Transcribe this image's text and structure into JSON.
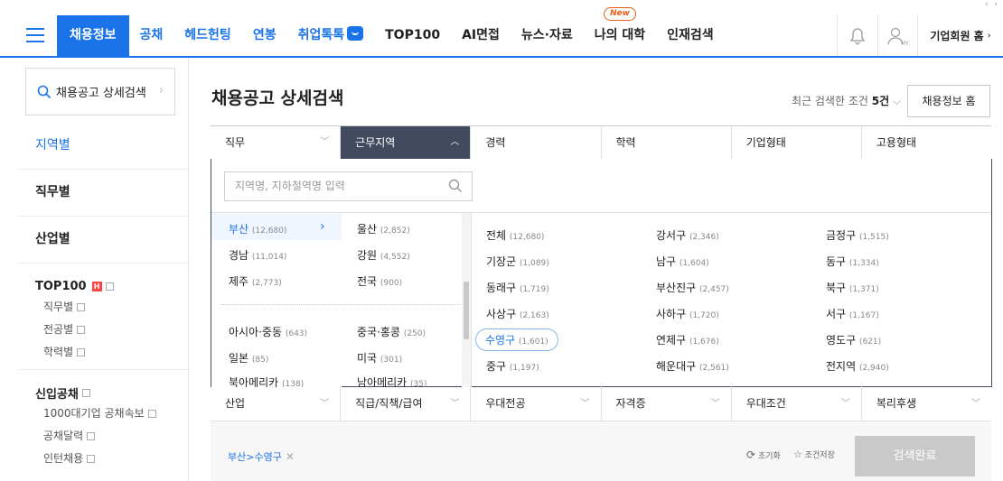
{
  "header": {
    "menu": [
      {
        "label": "채용정보",
        "active": true
      },
      {
        "label": "공채"
      },
      {
        "label": "헤드헌팅"
      },
      {
        "label": "연봉"
      },
      {
        "label": "취업톡톡"
      },
      {
        "label": "TOP100"
      },
      {
        "label": "AI면접"
      },
      {
        "label": "뉴스·자료"
      },
      {
        "label": "나의 대학",
        "badge": "New"
      },
      {
        "label": "인재검색"
      }
    ],
    "my_label": "MY",
    "corp_label": "기업회원 홈"
  },
  "sidebar": {
    "search_label": "채용공고 상세검색",
    "big_items": [
      "지역별",
      "직무별",
      "산업별"
    ],
    "top100": {
      "title": "TOP100",
      "hot_badge": "H",
      "subs": [
        "직무별",
        "전공별",
        "학력별"
      ]
    },
    "gongchae": {
      "title": "신입공채",
      "subs": [
        "1000대기업 공채속보",
        "공채달력",
        "인턴채용"
      ]
    }
  },
  "main": {
    "title": "채용공고 상세검색",
    "recent_prefix": "최근 검색한 조건 ",
    "recent_count": "5건",
    "home_button": "채용정보 홈",
    "tabs": [
      "직무",
      "근무지역",
      "경력",
      "학력",
      "기업형태",
      "고용형태"
    ],
    "region_search_placeholder": "지역명, 지하철역명 입력",
    "regions_left": [
      {
        "name": "부산",
        "count": "(12,680)"
      },
      {
        "name": "경남",
        "count": "(11,014)"
      },
      {
        "name": "제주",
        "count": "(2,773)"
      },
      {
        "name": "아시아·중동",
        "count": "(643)"
      },
      {
        "name": "일본",
        "count": "(85)"
      },
      {
        "name": "북아메리카",
        "count": "(138)"
      }
    ],
    "regions_right": [
      {
        "name": "울산",
        "count": "(2,852)"
      },
      {
        "name": "강원",
        "count": "(4,552)"
      },
      {
        "name": "전국",
        "count": "(900)"
      },
      {
        "name": "중국·홍콩",
        "count": "(250)"
      },
      {
        "name": "미국",
        "count": "(301)"
      },
      {
        "name": "남아메리카",
        "count": "(35)"
      }
    ],
    "districts": [
      [
        {
          "name": "전체",
          "count": "(12,680)"
        },
        {
          "name": "강서구",
          "count": "(2,346)"
        },
        {
          "name": "금정구",
          "count": "(1,515)"
        }
      ],
      [
        {
          "name": "기장군",
          "count": "(1,089)"
        },
        {
          "name": "남구",
          "count": "(1,604)"
        },
        {
          "name": "동구",
          "count": "(1,334)"
        }
      ],
      [
        {
          "name": "동래구",
          "count": "(1,719)"
        },
        {
          "name": "부산진구",
          "count": "(2,457)"
        },
        {
          "name": "북구",
          "count": "(1,371)"
        }
      ],
      [
        {
          "name": "사상구",
          "count": "(2,163)"
        },
        {
          "name": "사하구",
          "count": "(1,720)"
        },
        {
          "name": "서구",
          "count": "(1,167)"
        }
      ],
      [
        {
          "name": "수영구",
          "count": "(1,601)",
          "selected": true
        },
        {
          "name": "연제구",
          "count": "(1,676)"
        },
        {
          "name": "영도구",
          "count": "(621)"
        }
      ],
      [
        {
          "name": "중구",
          "count": "(1,197)"
        },
        {
          "name": "해운대구",
          "count": "(2,561)"
        },
        {
          "name": "전지역",
          "count": "(2,940)"
        }
      ]
    ],
    "tabs2": [
      "산업",
      "직급/직책/급여",
      "우대전공",
      "자격증",
      "우대조건",
      "복리후생"
    ],
    "chip": "부산>수영구",
    "reset_label": "초기화",
    "save_label": "조건저장",
    "done_button": "검색완료"
  },
  "colors": {
    "accent": "#1a73e8",
    "active_tab": "#424a5f"
  }
}
